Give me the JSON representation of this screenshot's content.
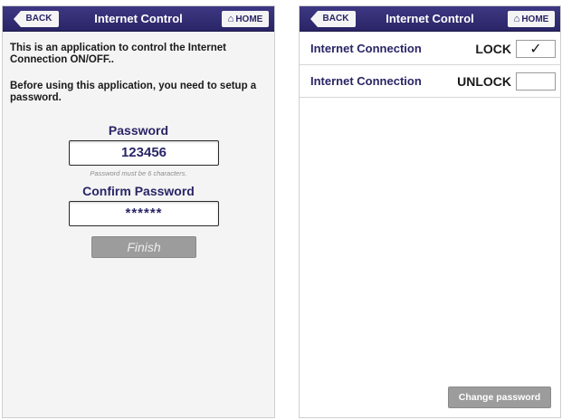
{
  "left": {
    "nav": {
      "back_label": "BACK",
      "title": "Internet Control",
      "home_label": "HOME",
      "home_icon": "home-icon"
    },
    "intro_text": "This is an application to control the Internet Connection ON/OFF..",
    "setup_text": "Before using this application, you need to setup a password.",
    "password_label": "Password",
    "password_value": "123456",
    "password_hint": "Password must be 6 characters.",
    "confirm_label": "Confirm Password",
    "confirm_value": "******",
    "finish_label": "Finish"
  },
  "right": {
    "nav": {
      "back_label": "BACK",
      "title": "Internet Control",
      "home_label": "HOME",
      "home_icon": "home-icon"
    },
    "rows": [
      {
        "label": "Internet Connection",
        "state": "LOCK",
        "checked": true,
        "check_mark": "✓"
      },
      {
        "label": "Internet Connection",
        "state": "UNLOCK",
        "checked": false,
        "check_mark": ""
      }
    ],
    "change_password_label": "Change password"
  },
  "colors": {
    "navbar": "#2a2566",
    "accent_text": "#2a2566",
    "button_gray": "#9c9c9c"
  }
}
